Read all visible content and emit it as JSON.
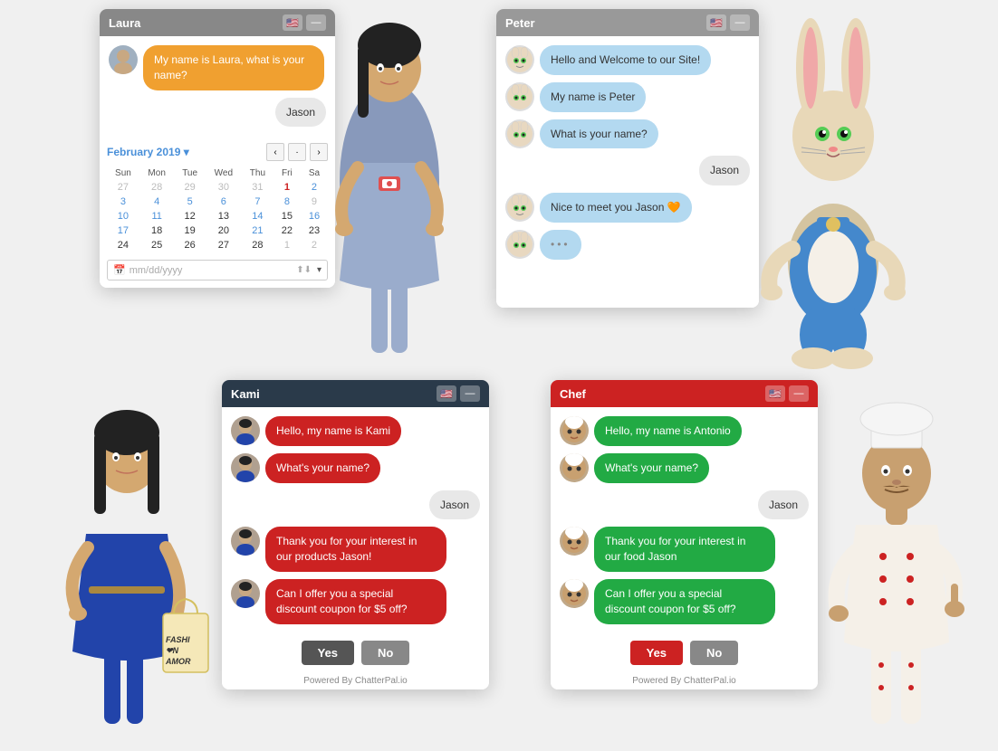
{
  "laura": {
    "title": "Laura",
    "header_bg": "#888888",
    "messages": [
      {
        "type": "bot",
        "text": "My name is Laura, what is your name?",
        "bubble": "orange"
      },
      {
        "type": "user",
        "text": "Jason",
        "bubble": "user"
      }
    ],
    "calendar": {
      "month_label": "February 2019",
      "days_header": [
        "Sun",
        "Mon",
        "Tue",
        "Wed",
        "Thu",
        "Fri",
        "Sa"
      ],
      "weeks": [
        [
          {
            "n": "27",
            "c": "gray"
          },
          {
            "n": "28",
            "c": "gray"
          },
          {
            "n": "29",
            "c": "gray"
          },
          {
            "n": "30",
            "c": "gray"
          },
          {
            "n": "31",
            "c": "gray"
          },
          {
            "n": "1",
            "c": "red"
          },
          {
            "n": "2",
            "c": "blue"
          }
        ],
        [
          {
            "n": "3",
            "c": "blue"
          },
          {
            "n": "4",
            "c": "blue"
          },
          {
            "n": "5",
            "c": "blue"
          },
          {
            "n": "6",
            "c": "blue"
          },
          {
            "n": "7",
            "c": "blue"
          },
          {
            "n": "8",
            "c": "blue"
          },
          {
            "n": "9",
            "c": "gray"
          }
        ],
        [
          {
            "n": "10",
            "c": "blue"
          },
          {
            "n": "11",
            "c": "blue"
          },
          {
            "n": "12",
            "c": "normal"
          },
          {
            "n": "13",
            "c": "normal"
          },
          {
            "n": "14",
            "c": "blue"
          },
          {
            "n": "15",
            "c": "normal"
          },
          {
            "n": "16",
            "c": "blue"
          }
        ],
        [
          {
            "n": "17",
            "c": "blue"
          },
          {
            "n": "18",
            "c": "normal"
          },
          {
            "n": "19",
            "c": "normal"
          },
          {
            "n": "20",
            "c": "normal"
          },
          {
            "n": "21",
            "c": "blue"
          },
          {
            "n": "22",
            "c": "normal"
          },
          {
            "n": "23",
            "c": "normal"
          }
        ],
        [
          {
            "n": "24",
            "c": "normal"
          },
          {
            "n": "25",
            "c": "normal"
          },
          {
            "n": "26",
            "c": "normal"
          },
          {
            "n": "27",
            "c": "normal"
          },
          {
            "n": "28",
            "c": "normal"
          },
          {
            "n": "1",
            "c": "gray"
          },
          {
            "n": "2",
            "c": "gray"
          }
        ]
      ],
      "date_placeholder": "mm/dd/yyyy"
    }
  },
  "peter": {
    "title": "Peter",
    "header_bg": "#999999",
    "messages": [
      {
        "type": "bot",
        "text": "Hello and Welcome to our Site!",
        "bubble": "blue"
      },
      {
        "type": "bot",
        "text": "My name is Peter",
        "bubble": "blue"
      },
      {
        "type": "bot",
        "text": "What is your name?",
        "bubble": "blue"
      },
      {
        "type": "user",
        "text": "Jason",
        "bubble": "user"
      },
      {
        "type": "bot",
        "text": "Nice to meet you Jason 🧡",
        "bubble": "blue"
      },
      {
        "type": "bot",
        "text": "typing",
        "bubble": "blue"
      }
    ]
  },
  "kami": {
    "title": "Kami",
    "header_bg": "#2a3a4a",
    "messages": [
      {
        "type": "bot",
        "text": "Hello, my name is Kami",
        "bubble": "red"
      },
      {
        "type": "bot",
        "text": "What's your name?",
        "bubble": "red"
      },
      {
        "type": "user",
        "text": "Jason",
        "bubble": "user"
      },
      {
        "type": "bot",
        "text": "Thank you for your interest in our products Jason!",
        "bubble": "red"
      },
      {
        "type": "bot",
        "text": "Can I offer you a special discount coupon for $5 off?",
        "bubble": "red"
      }
    ],
    "yes_label": "Yes",
    "no_label": "No",
    "powered_by": "Powered By ChatterPal.io"
  },
  "chef": {
    "title": "Chef",
    "header_bg": "#cc2222",
    "messages": [
      {
        "type": "bot",
        "text": "Hello, my name is Antonio",
        "bubble": "green"
      },
      {
        "type": "bot",
        "text": "What's your name?",
        "bubble": "green"
      },
      {
        "type": "user",
        "text": "Jason",
        "bubble": "user"
      },
      {
        "type": "bot",
        "text": "Thank you for your interest in our food Jason",
        "bubble": "green"
      },
      {
        "type": "bot",
        "text": "Can I offer you a special discount coupon for $5 off?",
        "bubble": "green"
      }
    ],
    "yes_label": "Yes",
    "no_label": "No",
    "powered_by": "Powered By ChatterPal.io"
  },
  "buttons": {
    "minimize": "—",
    "flag": "🇺🇸"
  }
}
